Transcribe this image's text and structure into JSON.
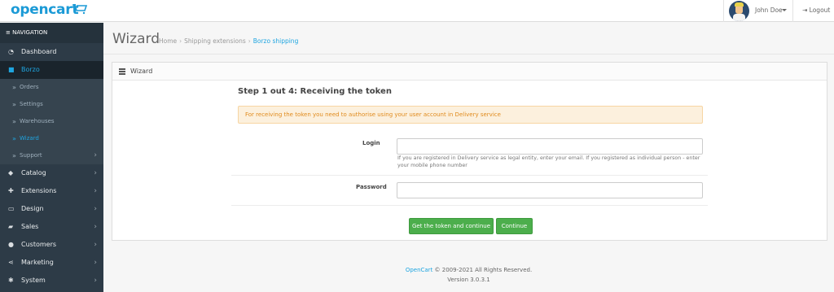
{
  "header": {
    "logo_text": "opencart",
    "user_name": "John Doe",
    "logout_label": "Logout"
  },
  "sidebar": {
    "title": "NAVIGATION",
    "items": [
      {
        "label": "Dashboard",
        "icon": "dashboard-icon"
      },
      {
        "label": "Borzo",
        "icon": "truck-icon",
        "active": true
      },
      {
        "label": "Catalog",
        "icon": "tag-icon"
      },
      {
        "label": "Extensions",
        "icon": "puzzle-icon"
      },
      {
        "label": "Design",
        "icon": "monitor-icon"
      },
      {
        "label": "Sales",
        "icon": "cart-icon"
      },
      {
        "label": "Customers",
        "icon": "user-icon"
      },
      {
        "label": "Marketing",
        "icon": "share-icon"
      },
      {
        "label": "System",
        "icon": "cog-icon"
      }
    ],
    "subitems": [
      {
        "label": "Orders"
      },
      {
        "label": "Settings"
      },
      {
        "label": "Warehouses"
      },
      {
        "label": "Wizard",
        "active": true
      },
      {
        "label": "Support"
      }
    ]
  },
  "page": {
    "title": "Wizard",
    "breadcrumb": [
      "Home",
      "Shipping extensions",
      "Borzo shipping"
    ]
  },
  "panel": {
    "title": "Wizard",
    "step_title": "Step 1 out 4: Receiving the token",
    "alert": "For receiving the token you need to authorise using your user account in Delivery service",
    "login_label": "Login",
    "login_value": "",
    "login_help": "If you are registered in Delivery service as legal entity, enter your email. If you registered as individual person - enter your mobile phone number",
    "password_label": "Password",
    "password_value": "",
    "btn_get_token": "Get the token and continue",
    "btn_continue": "Continue"
  },
  "footer": {
    "link": "OpenCart",
    "copyright": "© 2009-2021 All Rights Reserved.",
    "version": "Version 3.0.3.1"
  },
  "colors": {
    "accent": "#1fa5e0",
    "sidebar_bg": "#2d3b47",
    "button_green": "#4cae4c",
    "alert_bg": "#fcf0dd",
    "alert_text": "#e08a1c"
  }
}
